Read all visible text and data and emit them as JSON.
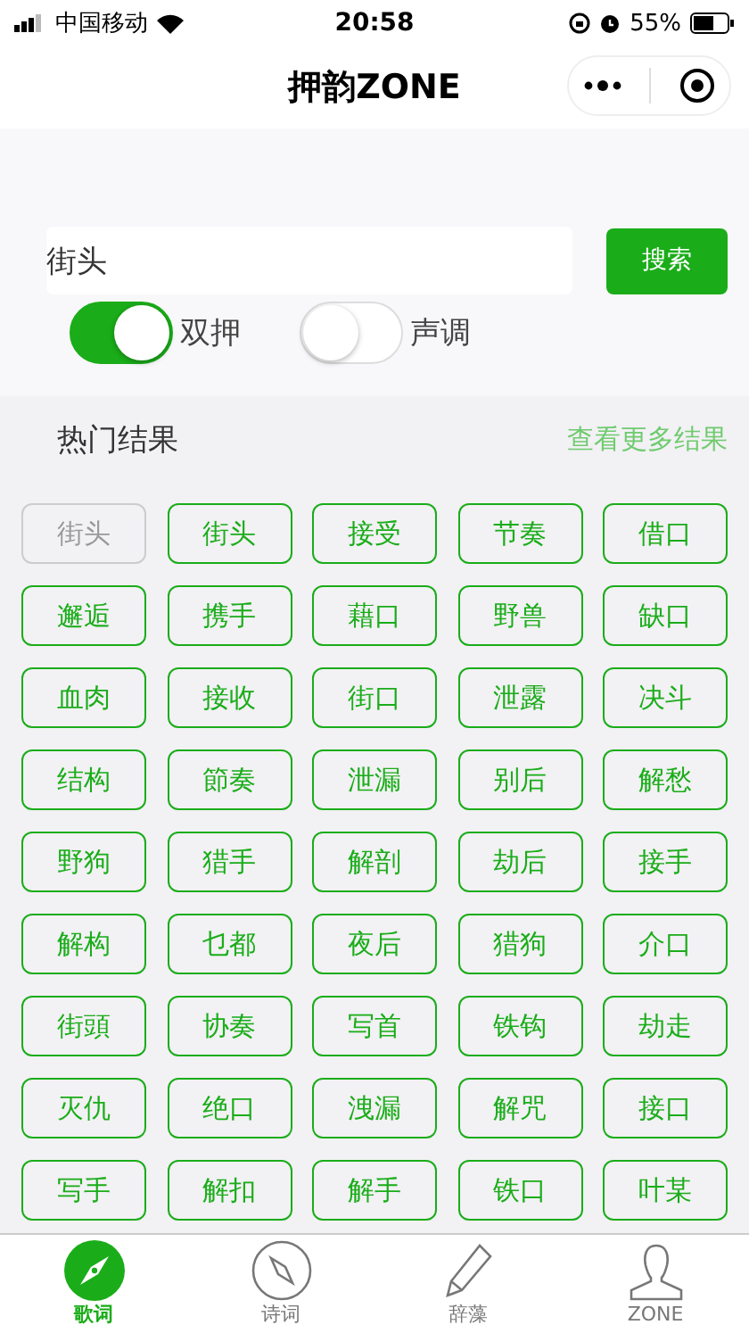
{
  "status_bar": {
    "carrier": "中国移动",
    "time": "20:58",
    "battery": "55%"
  },
  "nav": {
    "title": "押韵ZONE"
  },
  "search": {
    "value": "街头",
    "button": "搜索"
  },
  "toggles": [
    {
      "label": "双押",
      "on": true
    },
    {
      "label": "声调",
      "on": false
    }
  ],
  "section": {
    "title": "热门结果",
    "more": "查看更多结果"
  },
  "results": [
    {
      "text": "街头",
      "disabled": true
    },
    {
      "text": "街头",
      "disabled": false
    },
    {
      "text": "接受",
      "disabled": false
    },
    {
      "text": "节奏",
      "disabled": false
    },
    {
      "text": "借口",
      "disabled": false
    },
    {
      "text": "邂逅",
      "disabled": false
    },
    {
      "text": "携手",
      "disabled": false
    },
    {
      "text": "藉口",
      "disabled": false
    },
    {
      "text": "野兽",
      "disabled": false
    },
    {
      "text": "缺口",
      "disabled": false
    },
    {
      "text": "血肉",
      "disabled": false
    },
    {
      "text": "接收",
      "disabled": false
    },
    {
      "text": "街口",
      "disabled": false
    },
    {
      "text": "泄露",
      "disabled": false
    },
    {
      "text": "决斗",
      "disabled": false
    },
    {
      "text": "结构",
      "disabled": false
    },
    {
      "text": "節奏",
      "disabled": false
    },
    {
      "text": "泄漏",
      "disabled": false
    },
    {
      "text": "别后",
      "disabled": false
    },
    {
      "text": "解愁",
      "disabled": false
    },
    {
      "text": "野狗",
      "disabled": false
    },
    {
      "text": "猎手",
      "disabled": false
    },
    {
      "text": "解剖",
      "disabled": false
    },
    {
      "text": "劫后",
      "disabled": false
    },
    {
      "text": "接手",
      "disabled": false
    },
    {
      "text": "解构",
      "disabled": false
    },
    {
      "text": "乜都",
      "disabled": false
    },
    {
      "text": "夜后",
      "disabled": false
    },
    {
      "text": "猎狗",
      "disabled": false
    },
    {
      "text": "介口",
      "disabled": false
    },
    {
      "text": "街頭",
      "disabled": false
    },
    {
      "text": "协奏",
      "disabled": false
    },
    {
      "text": "写首",
      "disabled": false
    },
    {
      "text": "铁钩",
      "disabled": false
    },
    {
      "text": "劫走",
      "disabled": false
    },
    {
      "text": "灭仇",
      "disabled": false
    },
    {
      "text": "绝口",
      "disabled": false
    },
    {
      "text": "洩漏",
      "disabled": false
    },
    {
      "text": "解咒",
      "disabled": false
    },
    {
      "text": "接口",
      "disabled": false
    },
    {
      "text": "写手",
      "disabled": false
    },
    {
      "text": "解扣",
      "disabled": false
    },
    {
      "text": "解手",
      "disabled": false
    },
    {
      "text": "铁口",
      "disabled": false
    },
    {
      "text": "叶某",
      "disabled": false
    }
  ],
  "tabs": [
    {
      "label": "歌词",
      "kind": "compass",
      "selected": true
    },
    {
      "label": "诗词",
      "kind": "compass",
      "selected": false
    },
    {
      "label": "辞藻",
      "kind": "pencil",
      "selected": false
    },
    {
      "label": "ZONE",
      "kind": "person",
      "selected": false
    }
  ]
}
